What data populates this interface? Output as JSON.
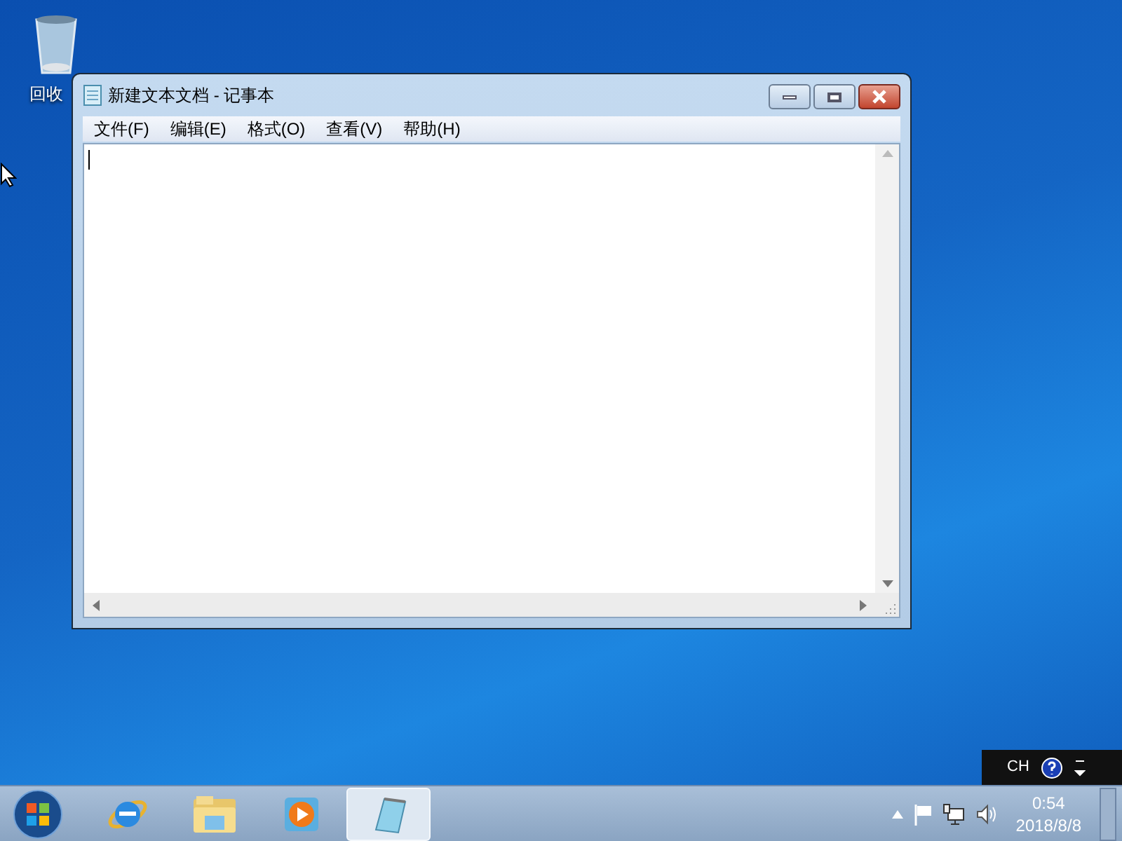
{
  "desktop_icons": [
    {
      "label": "回收"
    }
  ],
  "window": {
    "title": "新建文本文档 - 记事本",
    "menu": [
      {
        "label": "文件(F)"
      },
      {
        "label": "编辑(E)"
      },
      {
        "label": "格式(O)"
      },
      {
        "label": "查看(V)"
      },
      {
        "label": "帮助(H)"
      }
    ]
  },
  "taskbar": {
    "items": [
      {
        "kind": "browser",
        "selected": false
      },
      {
        "kind": "folder",
        "selected": false
      },
      {
        "kind": "media",
        "selected": false
      },
      {
        "kind": "notepad",
        "selected": true
      }
    ]
  },
  "language_bar": {
    "language": "CH"
  },
  "clock": {
    "time": "0:54",
    "date": "2018/8/8"
  }
}
